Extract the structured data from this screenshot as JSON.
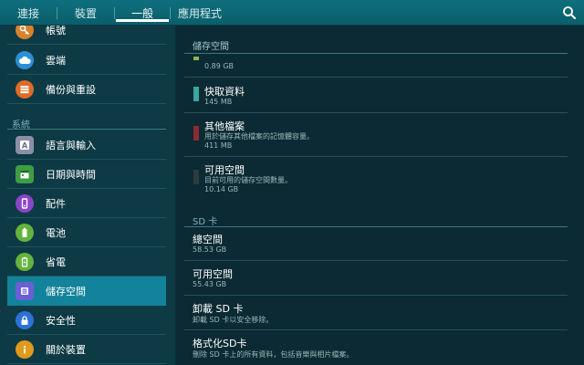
{
  "tabs": [
    {
      "label": "連接"
    },
    {
      "label": "裝置"
    },
    {
      "label": "一般"
    },
    {
      "label": "應用程式"
    }
  ],
  "active_tab": "一般",
  "search": {
    "icon": "search-icon"
  },
  "sidebar": {
    "items_top": [
      {
        "label": "帳號",
        "icon": "key-icon",
        "color": "#d8822b"
      },
      {
        "label": "雲端",
        "icon": "cloud-icon",
        "color": "#2c8fd6"
      },
      {
        "label": "備份與重設",
        "icon": "backup-icon",
        "color": "#e06a26"
      }
    ],
    "section_label": "系統",
    "items_system": [
      {
        "label": "語言與輸入",
        "icon": "keyboard-icon",
        "color": "#8b8fa6"
      },
      {
        "label": "日期與時間",
        "icon": "calendar-icon",
        "color": "#3f9c45"
      },
      {
        "label": "配件",
        "icon": "accessory-icon",
        "color": "#8a45c8"
      },
      {
        "label": "電池",
        "icon": "battery-icon",
        "color": "#63b33c"
      },
      {
        "label": "省電",
        "icon": "power-saving-icon",
        "color": "#63b33c"
      },
      {
        "label": "儲存空間",
        "icon": "storage-icon",
        "color": "#6b5fd8",
        "active": true
      },
      {
        "label": "安全性",
        "icon": "lock-icon",
        "color": "#2c72d6"
      },
      {
        "label": "關於裝置",
        "icon": "info-icon",
        "color": "#e09a1c"
      }
    ]
  },
  "main": {
    "title": "儲存空間",
    "partial_row": {
      "sub": "0.89 GB",
      "color": "#8fb34a"
    },
    "rows": [
      {
        "title": "快取資料",
        "sub": "145 MB",
        "color": "#3aa6a0"
      },
      {
        "title": "其他檔案",
        "desc": "用於儲存其他檔案的記憶體容量。",
        "sub": "411 MB",
        "color": "#8c2b34"
      },
      {
        "title": "可用空間",
        "desc": "目前可用的儲存空間數量。",
        "sub": "10.14 GB",
        "color": "#2a3c40"
      }
    ],
    "sd_header": "SD 卡",
    "sd_rows": [
      {
        "title": "總空間",
        "sub": "58.53 GB"
      },
      {
        "title": "可用空間",
        "sub": "55.43 GB"
      },
      {
        "title": "卸載 SD 卡",
        "sub": "卸載 SD 卡以安全移除。"
      },
      {
        "title": "格式化SD卡",
        "sub": "刪除 SD 卡上的所有資料，包括音樂與相片檔案。"
      }
    ]
  }
}
